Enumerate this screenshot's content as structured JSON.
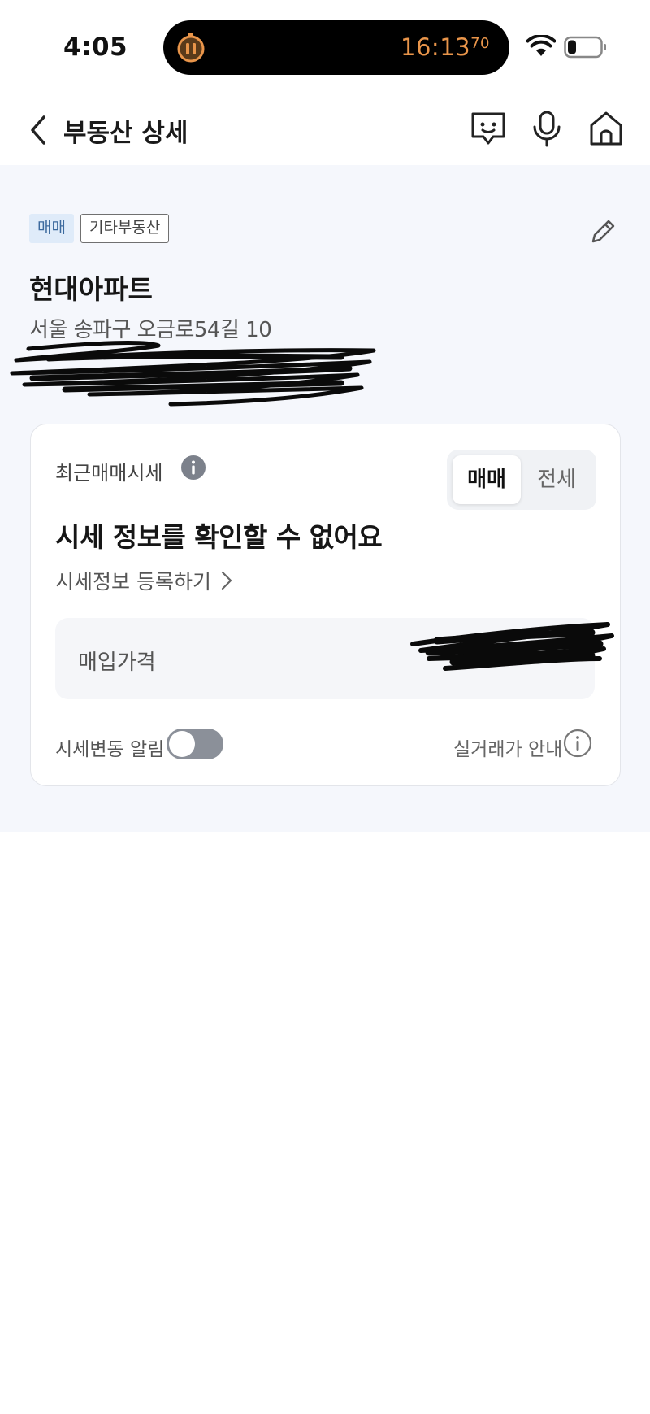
{
  "status_bar": {
    "time": "4:05",
    "activity_timer": "16:13",
    "activity_timer_fraction": "70"
  },
  "header": {
    "title": "부동산 상세"
  },
  "property": {
    "tags": [
      "매매",
      "기타부동산"
    ],
    "name": "현대아파트",
    "address": "서울 송파구 오금로54길 10"
  },
  "price_card": {
    "label": "최근매매시세",
    "segments": [
      "매매",
      "전세"
    ],
    "selected_segment": "매매",
    "message": "시세 정보를 확인할 수 없어요",
    "register_link": "시세정보 등록하기",
    "purchase_label": "매입가격",
    "alert_label": "시세변동 알림",
    "alert_enabled": false,
    "guide_label": "실거래가 안내"
  },
  "colors": {
    "accent_tag_bg": "#dfebf9",
    "accent_tag_text": "#3c6a9e",
    "timer_orange": "#e9954a",
    "content_bg": "#f5f7fc"
  }
}
